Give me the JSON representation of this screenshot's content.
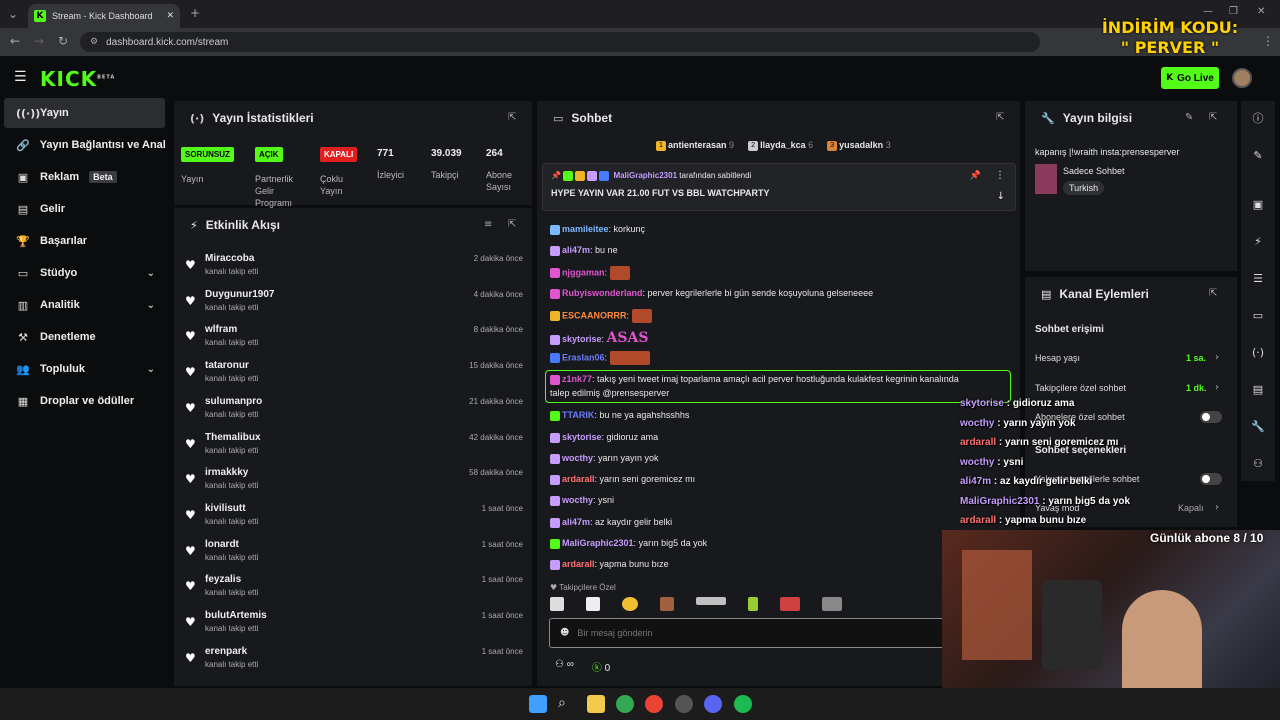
{
  "browser": {
    "tab_title": "Stream - Kick Dashboard",
    "url": "dashboard.kick.com/stream"
  },
  "promo": {
    "line1": "İNDİRİM KODU:",
    "line2": "\" PERVER \""
  },
  "header": {
    "logo": "KICK",
    "logo_sup": "BETA",
    "golive_label": "Go Live"
  },
  "sidebar": {
    "items": [
      {
        "label": "Yayın",
        "icon": "broadcast-icon"
      },
      {
        "label": "Yayın Bağlantısı ve Anahtar",
        "icon": "link-icon"
      },
      {
        "label": "Reklam",
        "icon": "ad-icon",
        "badge": "Beta"
      },
      {
        "label": "Gelir",
        "icon": "revenue-icon"
      },
      {
        "label": "Başarılar",
        "icon": "trophy-icon"
      },
      {
        "label": "Stüdyo",
        "icon": "studio-icon"
      },
      {
        "label": "Analitik",
        "icon": "analytics-icon"
      },
      {
        "label": "Denetleme",
        "icon": "moderation-icon"
      },
      {
        "label": "Topluluk",
        "icon": "community-icon"
      },
      {
        "label": "Droplar ve ödüller",
        "icon": "drops-icon"
      }
    ]
  },
  "stats": {
    "title": "Yayın İstatistikleri",
    "items": [
      {
        "badge": "SORUNSUZ",
        "label": "Yayın"
      },
      {
        "badge": "AÇIK",
        "label": "Partnerlik Gelir Programı"
      },
      {
        "badge": "KAPALI",
        "label": "Çoklu Yayın"
      },
      {
        "value": "771",
        "label": "İzleyici"
      },
      {
        "value": "39.039",
        "label": "Takipçi"
      },
      {
        "value": "264",
        "label": "Abone Sayısı"
      }
    ]
  },
  "activity": {
    "title": "Etkinlik Akışı",
    "sub": "kanalı takip etti",
    "events": [
      {
        "name": "Miraccoba",
        "time": "2 dakika önce"
      },
      {
        "name": "Duygunur1907",
        "time": "4 dakika önce"
      },
      {
        "name": "wlfram",
        "time": "8 dakika önce"
      },
      {
        "name": "tataronur",
        "time": "15 dakika önce"
      },
      {
        "name": "sulumanpro",
        "time": "21 dakika önce"
      },
      {
        "name": "Themalibux",
        "time": "42 dakika önce"
      },
      {
        "name": "irmakkky",
        "time": "58 dakika önce"
      },
      {
        "name": "kivilisutt",
        "time": "1 saat önce"
      },
      {
        "name": "lonardt",
        "time": "1 saat önce"
      },
      {
        "name": "feyzalis",
        "time": "1 saat önce"
      },
      {
        "name": "bulutArtemis",
        "time": "1 saat önce"
      },
      {
        "name": "erenpark",
        "time": "1 saat önce"
      }
    ]
  },
  "chat": {
    "title": "Sohbet",
    "top_gifters": [
      {
        "name": "antienterasan",
        "count": "9"
      },
      {
        "name": "llayda_kca",
        "count": "6"
      },
      {
        "name": "yusadalkn",
        "count": "3"
      }
    ],
    "pinned_by": "MaliGraphic2301",
    "pinned_suffix": "tarafından sabitlendi",
    "pinned_text": "HYPE YAYIN VAR 21.00 FUT VS BBL WATCHPARTY",
    "messages": [
      {
        "user": "mamileitee",
        "color": "#7ab8ff",
        "text": "korkunç"
      },
      {
        "user": "ali47m",
        "color": "#c69cff",
        "text": "bu ne"
      },
      {
        "user": "njggaman",
        "color": "#e055d0",
        "text": ""
      },
      {
        "user": "Rubyiswonderland",
        "color": "#e055d0",
        "text": "perver kegrilerlerle bi gün sende koşuyoluna gelseneeee"
      },
      {
        "user": "ESCAANORRR",
        "color": "#ff8a3d",
        "text": ""
      },
      {
        "user": "skytorise",
        "color": "#c69cff",
        "text": "ASAS"
      },
      {
        "user": "Eraslan06",
        "color": "#6a7bff",
        "text": ""
      },
      {
        "user": "z1nk77",
        "color": "#e055d0",
        "text": "takış yeni tweet imaj toparlama amaçlı acil perver hostluğunda kulakfest kegrinin kanalında"
      },
      {
        "user": "",
        "color": "#e8e8e8",
        "text": "talep edilmiş @prensesperver"
      },
      {
        "user": "TTARIK",
        "color": "#6a7bff",
        "text": "bu ne ya agahshsshhs"
      },
      {
        "user": "skytorise",
        "color": "#c69cff",
        "text": "gidioruz ama"
      },
      {
        "user": "wocthy",
        "color": "#c69cff",
        "text": "yarın yayın yok"
      },
      {
        "user": "ardarall",
        "color": "#ff7070",
        "text": "yarın seni goremicez mı"
      },
      {
        "user": "wocthy",
        "color": "#c69cff",
        "text": "ysni"
      },
      {
        "user": "ali47m",
        "color": "#c69cff",
        "text": "az kaydır gelir belki"
      },
      {
        "user": "MaliGraphic2301",
        "color": "#c69cff",
        "text": "yarın big5 da yok"
      },
      {
        "user": "ardarall",
        "color": "#ff7070",
        "text": "yapma bunu bıze"
      }
    ],
    "emote_section": "Takipçilere Özel",
    "input_placeholder": "Bir mesaj gönderin",
    "footer_infinity": "∞",
    "footer_count": "0"
  },
  "stream_info": {
    "title": "Yayın bilgisi",
    "stream_title": "kapanış |!wraith insta:prensesperver",
    "category": "Sadece Sohbet",
    "tag": "Turkish"
  },
  "channel_actions": {
    "title": "Kanal Eylemleri",
    "section1": "Sohbet erişimi",
    "rows": [
      {
        "label": "Hesap yaşı",
        "value": "1 sa."
      },
      {
        "label": "Takipçilere özel sohbet",
        "value": "1 dk."
      },
      {
        "label": "Abonelere özel sohbet",
        "value": ""
      }
    ],
    "section2": "Sohbet seçenekleri",
    "rows2": [
      {
        "label": "Yalnızca emojilerle sohbet",
        "value": ""
      },
      {
        "label": "Yavaş mod",
        "value": "Kapalı"
      }
    ]
  },
  "overlay": {
    "chat": [
      {
        "user": "skytorise",
        "color": "#c69cff",
        "text": "gidioruz ama"
      },
      {
        "user": "wocthy",
        "color": "#c69cff",
        "text": "yarın yayın yok"
      },
      {
        "user": "ardarall",
        "color": "#ff7070",
        "text": "yarın seni goremicez mı"
      },
      {
        "user": "wocthy",
        "color": "#c69cff",
        "text": "ysni"
      },
      {
        "user": "ali47m",
        "color": "#c69cff",
        "text": "az kaydır gelir belki"
      },
      {
        "user": "MaliGraphic2301",
        "color": "#c69cff",
        "text": "yarın big5 da yok"
      },
      {
        "user": "ardarall",
        "color": "#ff7070",
        "text": "yapma bunu bıze"
      }
    ],
    "sub_goal": "Günlük abone 8 / 10"
  },
  "colors": {
    "brand": "#53fc18",
    "panel": "#18191c",
    "bg": "#0b0c0d"
  }
}
